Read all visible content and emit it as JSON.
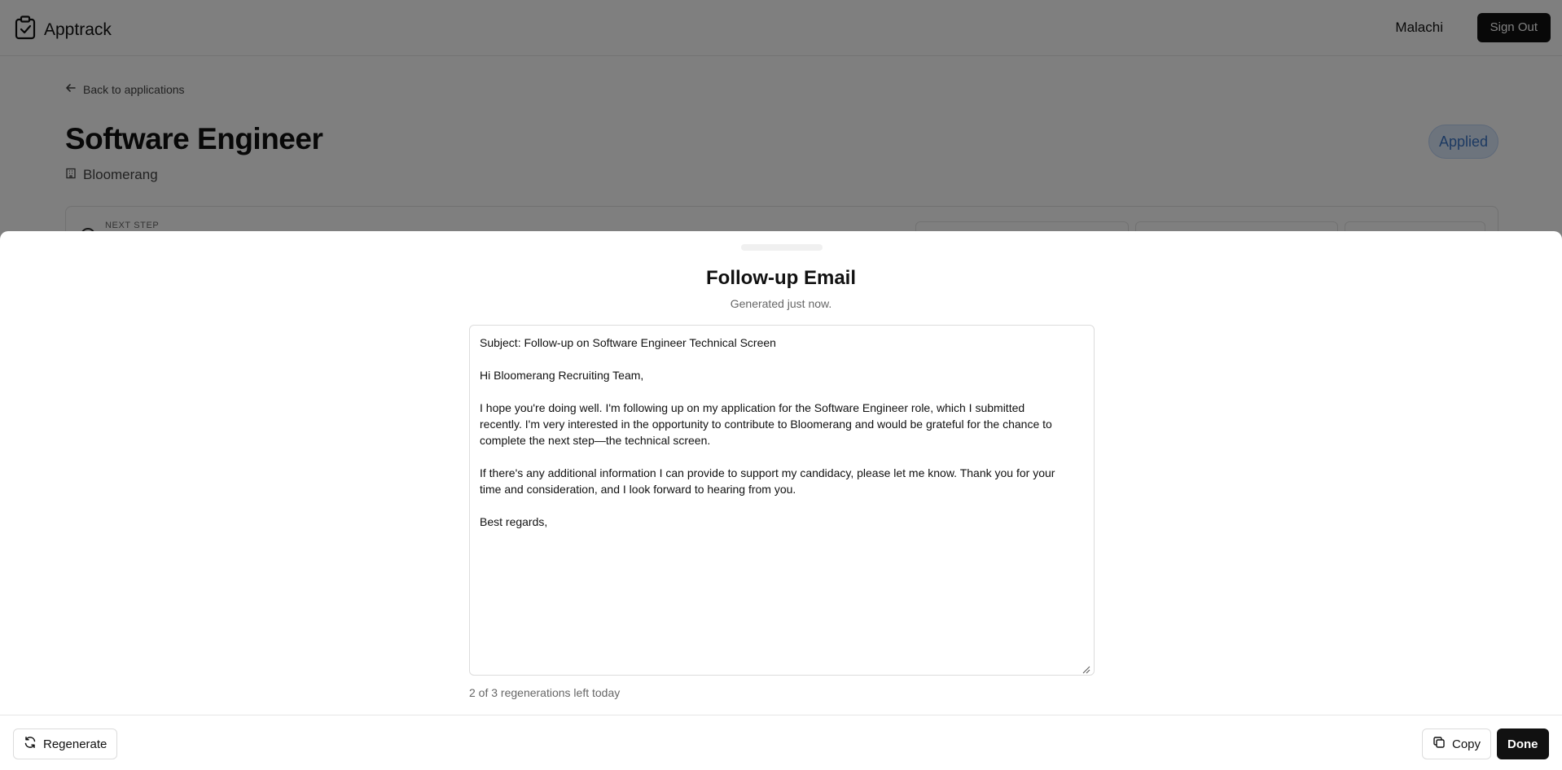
{
  "app": {
    "name": "Apptrack"
  },
  "header": {
    "user_name": "Malachi",
    "sign_out_label": "Sign Out"
  },
  "page": {
    "back_label": "Back to applications",
    "title": "Software Engineer",
    "company": "Bloomerang",
    "status": "Applied",
    "next_step_label": "NEXT STEP"
  },
  "modal": {
    "title": "Follow-up Email",
    "subtitle": "Generated just now.",
    "email": {
      "subject": "Subject: Follow-up on Software Engineer Technical Screen",
      "greeting": "Hi Bloomerang Recruiting Team,",
      "paragraph1_line1": "I hope you're doing well. I'm following up on my application for the Software Engineer role, which I submitted",
      "paragraph1_line2": "recently. I'm very interested in the opportunity to contribute to Bloomerang and would be grateful for the chance to",
      "paragraph1_line3": "complete the next step—the technical screen.",
      "paragraph2_line1": "If there's any additional information I can provide to support my candidacy, please let me know. Thank you for your",
      "paragraph2_line2": "time and consideration, and I look forward to hearing from you.",
      "signoff": "Best regards,"
    },
    "regenerations_left": "2 of 3 regenerations left today",
    "regenerate_label": "Regenerate",
    "copy_label": "Copy",
    "done_label": "Done"
  },
  "icons": {
    "logo": "clipboard-check-icon",
    "back": "arrow-left-icon",
    "company": "building-icon",
    "regenerate": "refresh-icon",
    "copy": "copy-icon"
  },
  "colors": {
    "status_bg": "#dbe8fb",
    "status_text": "#3a74c5",
    "primary_dark": "#111111"
  }
}
